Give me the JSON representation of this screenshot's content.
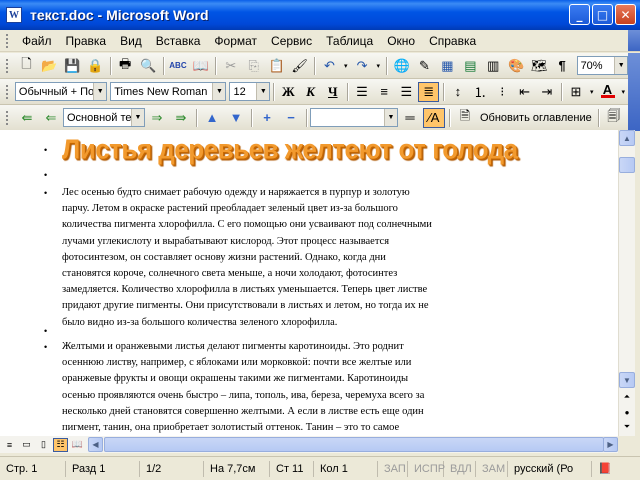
{
  "window": {
    "title": "текст.doc - Microsoft Word",
    "app_icon_letter": "W"
  },
  "menu": [
    "Файл",
    "Правка",
    "Вид",
    "Вставка",
    "Формат",
    "Сервис",
    "Таблица",
    "Окно",
    "Справка"
  ],
  "standard_toolbar": {
    "zoom": "70%",
    "pilcrow": "¶"
  },
  "formatting_toolbar": {
    "style": "Обычный + По ц",
    "font": "Times New Roman",
    "size": "12",
    "bold": "Ж",
    "italic": "К",
    "underline": "Ч",
    "font_color_letter": "А"
  },
  "outline_toolbar": {
    "level": "Основной текст",
    "update_toc": "Обновить оглавление",
    "plus": "+",
    "minus": "−"
  },
  "document": {
    "heading": "Листья деревьев желтеют от голода",
    "paragraph1": "Лес осенью будто снимает рабочую одежду и наряжается в пурпур и золотую парчу. Летом в окраске растений преобладает зеленый цвет из-за большого количества пигмента хлорофилла. С его помощью они усваивают под солнечными лучами углекислоту и вырабатывают кислород. Этот процесс называется фотосинтезом, он составляет основу жизни растений. Однако, когда дни становятся короче, солнечного света меньше, а ночи холодают, фотосинтез замедляется. Количество хлорофилла в листьях уменьшается. Теперь цвет листве придают другие пигменты. Они присутствовали в листьях и летом, но тогда их не было видно из-за большого количества зеленого хлорофилла.",
    "paragraph2": "Желтыми и оранжевыми листья делают пигменты каротиноиды. Это роднит осеннюю листву, например, с яблоками или морковкой: почти все желтые или оранжевые фрукты и овощи окрашены такими же пигментами. Каротиноиды осенью проявляются очень быстро – липа, тополь, ива, береза, черемуха всего за несколько дней становятся совершенно желтыми. А если в листве есть еще один пигмент, танин, она приобретает золотистый оттенок. Танин – это то самое вещество, которое в большом количестве содержится в",
    "bullet": "•"
  },
  "status": {
    "page": "Стр. 1",
    "section": "Разд 1",
    "pages": "1/2",
    "at": "На 7,7см",
    "line": "Ст 11",
    "col": "Кол 1",
    "rec": "ЗАП",
    "trk": "ИСПР",
    "ext": "ВДЛ",
    "ovr": "ЗАМ",
    "lang": "русский (Ро"
  },
  "colors": {
    "heading": "#F29A2E",
    "titlebar": "#0055E5"
  }
}
